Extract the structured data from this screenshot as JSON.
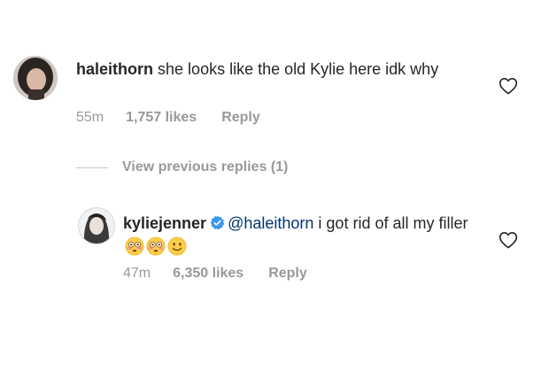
{
  "comments": [
    {
      "username": "haleithorn",
      "text": "she looks like the old Kylie here idk why",
      "time": "55m",
      "likes": "1,757 likes",
      "reply_label": "Reply"
    }
  ],
  "view_replies": {
    "label": "View previous replies (1)"
  },
  "replies": [
    {
      "username": "kyliejenner",
      "verified": true,
      "mention": "@haleithorn",
      "text": "i got rid of all my filler",
      "emojis": [
        "flushed-face",
        "flushed-face",
        "slightly-smiling-face"
      ],
      "time": "47m",
      "likes": "6,350 likes",
      "reply_label": "Reply"
    }
  ],
  "colors": {
    "text": "#262626",
    "secondary": "#999999",
    "mention": "#003569",
    "verified": "#3897f0"
  }
}
